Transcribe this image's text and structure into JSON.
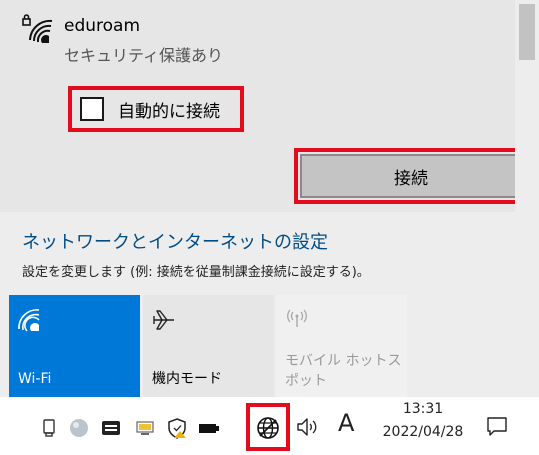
{
  "network": {
    "name": "eduroam",
    "status": "セキュリティ保護あり",
    "auto_connect_label": "自動的に接続",
    "auto_connect_checked": false,
    "connect_button": "接続"
  },
  "settings": {
    "link": "ネットワークとインターネットの設定",
    "description": "設定を変更します (例: 接続を従量制課金接続に設定する)。"
  },
  "quick_actions": {
    "wifi_label": "Wi-Fi",
    "airplane_label": "機内モード",
    "hotspot_label_line1": "モバイル ホットス",
    "hotspot_label_line2": "ポット"
  },
  "taskbar": {
    "ime": "A",
    "time": "13:31",
    "date": "2022/04/28"
  },
  "colors": {
    "accent": "#0078d7",
    "highlight": "#e30b1c",
    "link": "#004c87"
  }
}
